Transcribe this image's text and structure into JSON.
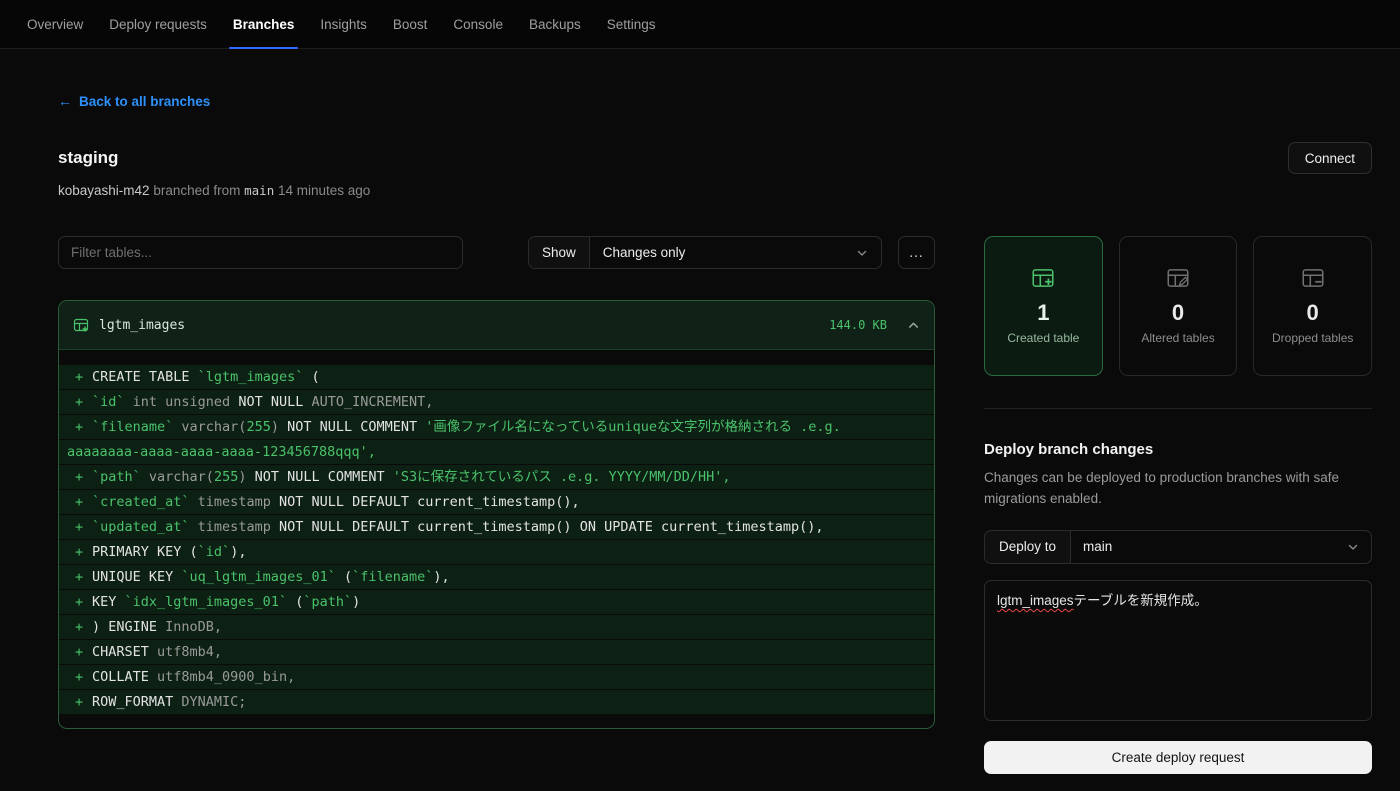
{
  "nav": {
    "items": [
      {
        "label": "Overview"
      },
      {
        "label": "Deploy requests"
      },
      {
        "label": "Branches"
      },
      {
        "label": "Insights"
      },
      {
        "label": "Boost"
      },
      {
        "label": "Console"
      },
      {
        "label": "Backups"
      },
      {
        "label": "Settings"
      }
    ],
    "active": "Branches"
  },
  "header": {
    "back_link": "Back to all branches",
    "back_arrow": "←",
    "branch_name": "staging",
    "author": "kobayashi-m42",
    "branched_text": "branched from",
    "parent_branch": "main",
    "time_ago": "14 minutes ago",
    "connect_label": "Connect"
  },
  "toolbar": {
    "filter_placeholder": "Filter tables...",
    "show_label": "Show",
    "show_value": "Changes only",
    "more_label": "…"
  },
  "diff": {
    "table_name": "lgtm_images",
    "size": "144.0 KB",
    "lines": [
      {
        "plus": true,
        "segs": [
          {
            "t": "CREATE TABLE ",
            "c": "k"
          },
          {
            "t": "`lgtm_images`",
            "c": "i"
          },
          {
            "t": " (",
            "c": "k"
          }
        ]
      },
      {
        "plus": true,
        "segs": [
          {
            "t": "`id`",
            "c": "i"
          },
          {
            "t": " int unsigned ",
            "c": "t"
          },
          {
            "t": "NOT NULL",
            "c": "k"
          },
          {
            "t": " AUTO_INCREMENT,",
            "c": "t"
          }
        ]
      },
      {
        "plus": true,
        "segs": [
          {
            "t": "`filename`",
            "c": "i"
          },
          {
            "t": " varchar(",
            "c": "t"
          },
          {
            "t": "255",
            "c": "n"
          },
          {
            "t": ") ",
            "c": "t"
          },
          {
            "t": "NOT NULL COMMENT ",
            "c": "k"
          },
          {
            "t": "'画像ファイル名になっているuniqueな文字列が格納される .e.g.",
            "c": "s"
          }
        ]
      },
      {
        "plus": false,
        "segs": [
          {
            "t": "aaaaaaaa-aaaa-aaaa-aaaa-123456788qqq',",
            "c": "s"
          }
        ]
      },
      {
        "plus": true,
        "segs": [
          {
            "t": "`path`",
            "c": "i"
          },
          {
            "t": " varchar(",
            "c": "t"
          },
          {
            "t": "255",
            "c": "n"
          },
          {
            "t": ") ",
            "c": "t"
          },
          {
            "t": "NOT NULL COMMENT ",
            "c": "k"
          },
          {
            "t": "'S3に保存されているパス .e.g. YYYY/MM/DD/HH',",
            "c": "s"
          }
        ]
      },
      {
        "plus": true,
        "segs": [
          {
            "t": "`created_at`",
            "c": "i"
          },
          {
            "t": " timestamp ",
            "c": "t"
          },
          {
            "t": "NOT NULL DEFAULT ",
            "c": "k"
          },
          {
            "t": "current_timestamp(),",
            "c": "k"
          }
        ]
      },
      {
        "plus": true,
        "segs": [
          {
            "t": "`updated_at`",
            "c": "i"
          },
          {
            "t": " timestamp ",
            "c": "t"
          },
          {
            "t": "NOT NULL DEFAULT ",
            "c": "k"
          },
          {
            "t": "current_timestamp()",
            "c": "k"
          },
          {
            "t": " ON UPDATE ",
            "c": "k"
          },
          {
            "t": "current_timestamp(),",
            "c": "k"
          }
        ]
      },
      {
        "plus": true,
        "segs": [
          {
            "t": "PRIMARY KEY (",
            "c": "k"
          },
          {
            "t": "`id`",
            "c": "i"
          },
          {
            "t": "),",
            "c": "k"
          }
        ]
      },
      {
        "plus": true,
        "segs": [
          {
            "t": "UNIQUE KEY ",
            "c": "k"
          },
          {
            "t": "`uq_lgtm_images_01`",
            "c": "i"
          },
          {
            "t": " (",
            "c": "k"
          },
          {
            "t": "`filename`",
            "c": "i"
          },
          {
            "t": "),",
            "c": "k"
          }
        ]
      },
      {
        "plus": true,
        "segs": [
          {
            "t": "KEY ",
            "c": "k"
          },
          {
            "t": "`idx_lgtm_images_01`",
            "c": "i"
          },
          {
            "t": " (",
            "c": "k"
          },
          {
            "t": "`path`",
            "c": "i"
          },
          {
            "t": ")",
            "c": "k"
          }
        ]
      },
      {
        "plus": true,
        "segs": [
          {
            "t": ") ENGINE ",
            "c": "k"
          },
          {
            "t": "InnoDB,",
            "c": "t"
          }
        ]
      },
      {
        "plus": true,
        "segs": [
          {
            "t": "CHARSET ",
            "c": "k"
          },
          {
            "t": "utf8mb4,",
            "c": "t"
          }
        ]
      },
      {
        "plus": true,
        "segs": [
          {
            "t": "COLLATE ",
            "c": "k"
          },
          {
            "t": "utf8mb4_0900_bin,",
            "c": "t"
          }
        ]
      },
      {
        "plus": true,
        "segs": [
          {
            "t": "ROW_FORMAT ",
            "c": "k"
          },
          {
            "t": "DYNAMIC;",
            "c": "t"
          }
        ]
      }
    ]
  },
  "stats": [
    {
      "value": "1",
      "label": "Created table"
    },
    {
      "value": "0",
      "label": "Altered tables"
    },
    {
      "value": "0",
      "label": "Dropped tables"
    }
  ],
  "deploy": {
    "heading": "Deploy branch changes",
    "description": "Changes can be deployed to production branches with safe migrations enabled.",
    "deploy_to_label": "Deploy to",
    "deploy_to_value": "main",
    "note_highlight": "lgtm_images",
    "note_rest": "テーブルを新規作成。",
    "submit_label": "Create deploy request"
  },
  "colors": {
    "accent_blue": "#3069fe",
    "link_blue": "#2e90fa",
    "diff_green": "#4ac26b",
    "added_row_bg": "#0c2013",
    "panel_border": "#2a5c38",
    "misspell_red": "#e5484d"
  }
}
